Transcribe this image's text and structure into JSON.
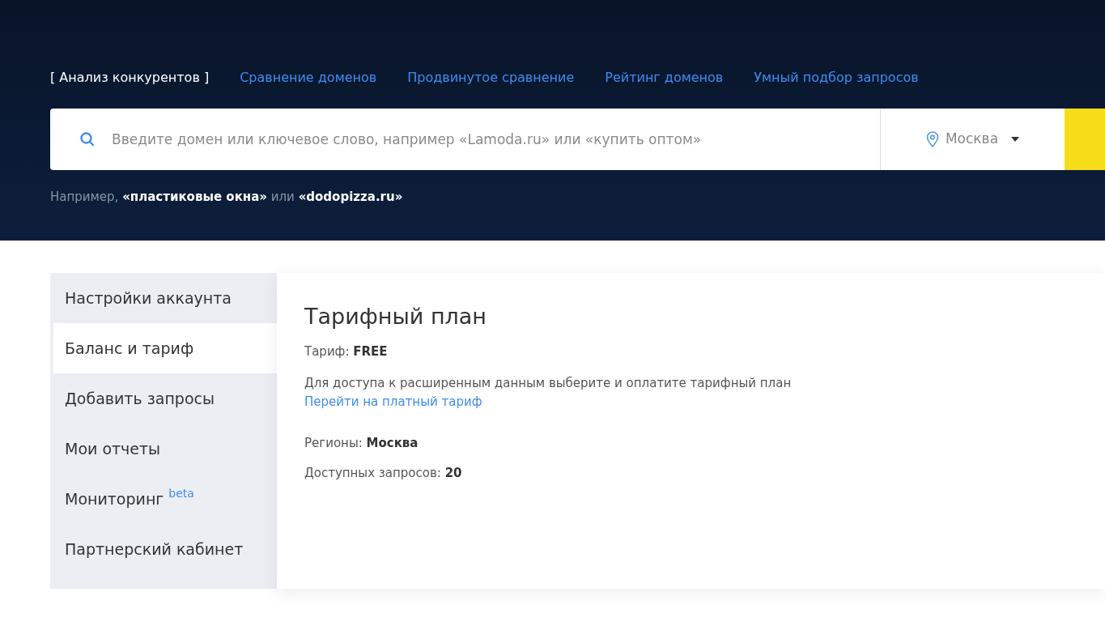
{
  "top_nav": [
    {
      "label": "[ Анализ конкурентов ]",
      "selected": true
    },
    {
      "label": "Сравнение доменов",
      "selected": false
    },
    {
      "label": "Продвинутое сравнение",
      "selected": false
    },
    {
      "label": "Рейтинг доменов",
      "selected": false
    },
    {
      "label": "Умный подбор запросов",
      "selected": false
    }
  ],
  "search": {
    "placeholder": "Введите домен или ключевое слово, например «Lamoda.ru» или «купить оптом»",
    "region": "Москва"
  },
  "example": "Например, **«пластиковые окна»** или **«dodopizza.ru»**",
  "sidebar": {
    "items": [
      {
        "label": "Настройки аккаунта",
        "selected": false
      },
      {
        "label": "Баланс и тариф",
        "selected": true
      },
      {
        "label": "Добавить запросы",
        "selected": false
      },
      {
        "label": "Мои отчеты",
        "selected": false
      },
      {
        "label": "Мониторинг $^{beta}$",
        "selected": false
      },
      {
        "label": "Партнерский кабинет",
        "selected": false
      }
    ]
  },
  "plan": {
    "title": "Тарифный план",
    "tariff": "Тариф: **FREE**",
    "description": "Для доступа к расширенным данным выберите и оплатите тарифный план",
    "upgrade_link": "Перейти на платный тариф",
    "regions": "Регионы: **Москва**",
    "queries": "Доступных запросов: **20**"
  }
}
